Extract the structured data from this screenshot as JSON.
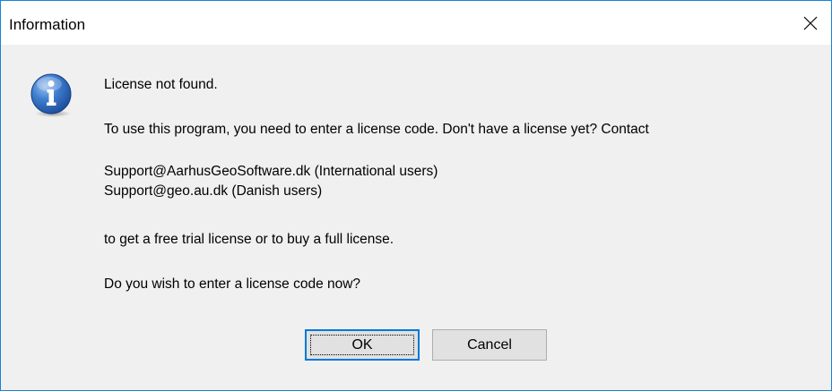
{
  "window": {
    "title": "Information",
    "close_symbol": "✕"
  },
  "icon": {
    "name": "information-icon",
    "glyph": "i",
    "color": "#2a5fb0"
  },
  "message": {
    "line1": "License not found.",
    "line2": "To use this program, you need to enter a license code. Don't have a license yet? Contact",
    "line3": "Support@AarhusGeoSoftware.dk (International users)",
    "line4": "Support@geo.au.dk (Danish users)",
    "line5": "to get a free trial license or to buy a full license.",
    "line6": "Do you wish to enter a license code now?"
  },
  "buttons": {
    "ok_label": "OK",
    "cancel_label": "Cancel"
  },
  "colors": {
    "dialog_background": "#f0f0f0",
    "accent_border": "#1883d7",
    "focused_button_border": "#0078d7"
  }
}
